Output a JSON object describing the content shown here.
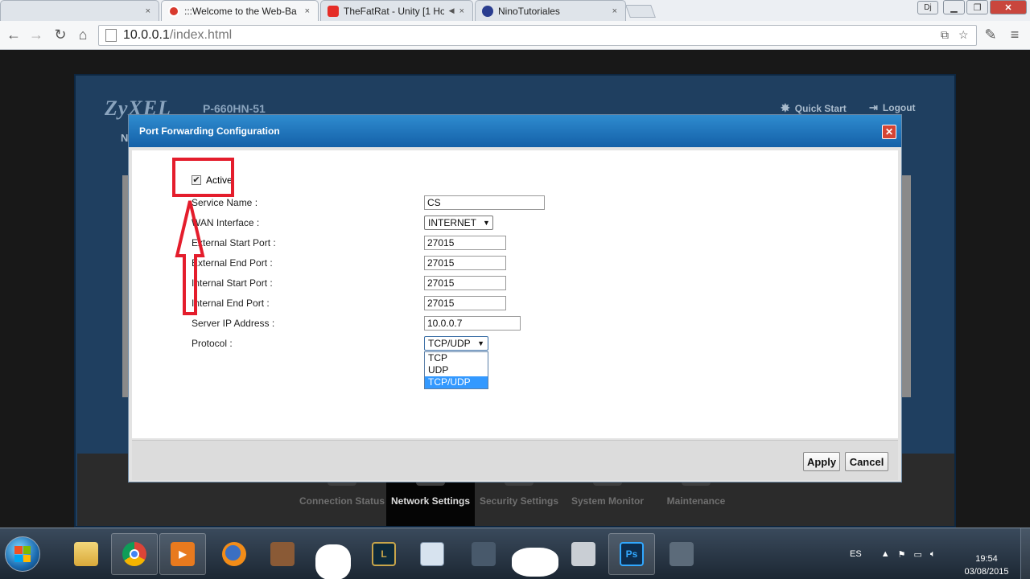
{
  "browser": {
    "tabs": [
      {
        "title": "",
        "closable": "×"
      },
      {
        "title": ":::Welcome to the Web-Ba",
        "closable": "×"
      },
      {
        "title": "TheFatRat - Unity [1 Ho",
        "closable": "×"
      },
      {
        "title": "NinoTutoriales",
        "closable": "×"
      }
    ],
    "user_badge": "Dj",
    "address": {
      "host": "10.0.0.1",
      "path": "/index.html"
    }
  },
  "router": {
    "brand": "ZyXEL",
    "model": "P-660HN-51",
    "quick_start": "Quick Start",
    "logout": "Logout",
    "nav_initial": "N",
    "bottom_nav": [
      "Connection Status",
      "Network Settings",
      "Security Settings",
      "System Monitor",
      "Maintenance"
    ]
  },
  "dialog": {
    "title": "Port Forwarding Configuration",
    "close_glyph": "✕",
    "active_label": "Active",
    "active_checked": true,
    "fields": {
      "service_name": {
        "label": "Service Name :",
        "value": "CS"
      },
      "wan_interface": {
        "label": "WAN Interface :",
        "value": "INTERNET"
      },
      "external_start_port": {
        "label": "External Start Port :",
        "value": "27015"
      },
      "external_end_port": {
        "label": "External End Port :",
        "value": "27015"
      },
      "internal_start_port": {
        "label": "Internal Start Port :",
        "value": "27015"
      },
      "internal_end_port": {
        "label": "Internal End Port :",
        "value": "27015"
      },
      "server_ip": {
        "label": "Server IP Address :",
        "value": "10.0.0.7"
      },
      "protocol": {
        "label": "Protocol :",
        "value": "TCP/UDP",
        "options": [
          "TCP",
          "UDP",
          "TCP/UDP"
        ],
        "selected_index": 2
      }
    },
    "apply_label": "Apply",
    "cancel_label": "Cancel"
  },
  "taskbar": {
    "language": "ES",
    "time": "19:54",
    "date": "03/08/2015",
    "photoshop_label": "Ps",
    "league_label": "L"
  },
  "colors": {
    "annotation_red": "#e41d2c",
    "dialog_title_blue": "#1a74bd",
    "selected_option": "#3399ff"
  }
}
